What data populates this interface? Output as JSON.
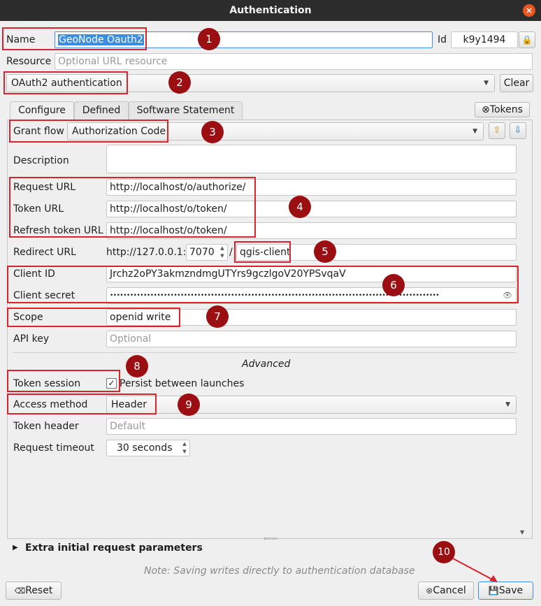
{
  "window": {
    "title": "Authentication",
    "close_icon": "×"
  },
  "name": {
    "label": "Name",
    "value": "GeoNode Oauth2"
  },
  "id": {
    "label": "Id",
    "value": "k9y1494",
    "lock_icon": "🔒"
  },
  "resource": {
    "label": "Resource",
    "placeholder": "Optional URL resource"
  },
  "method": {
    "selected": "OAuth2 authentication",
    "clear_label": "Clear"
  },
  "tabs": [
    {
      "label": "Configure"
    },
    {
      "label": "Defined"
    },
    {
      "label": "Software Statement"
    }
  ],
  "tokens_label": "Tokens",
  "tokens_icon": "⊗",
  "grant_flow": {
    "label": "Grant flow",
    "selected": "Authorization Code"
  },
  "description": {
    "label": "Description"
  },
  "request_url": {
    "label": "Request URL",
    "value": "http://localhost/o/authorize/"
  },
  "token_url": {
    "label": "Token URL",
    "value": "http://localhost/o/token/"
  },
  "refresh_url": {
    "label": "Refresh token URL",
    "value": "http://localhost/o/token/"
  },
  "redirect": {
    "label": "Redirect URL",
    "host": "http://127.0.0.1:",
    "port": "7070",
    "slash": "/",
    "path": "qgis-client"
  },
  "client_id": {
    "label": "Client ID",
    "value": "Jrchz2oPY3akmzndmgUTYrs9gczlgoV20YPSvqaV"
  },
  "client_secret": {
    "label": "Client secret",
    "value": "••••••••••••••••••••••••••••••••••••••••••••••••••••••••••••••••••••••••••••••••••••••••••••••••••",
    "eye_icon": "👁"
  },
  "scope": {
    "label": "Scope",
    "value": "openid write"
  },
  "api_key": {
    "label": "API key",
    "placeholder": "Optional"
  },
  "advanced_heading": "Advanced",
  "token_session": {
    "label": "Token session",
    "checkbox": "✓",
    "checkbox_label": "Persist between launches"
  },
  "access_method": {
    "label": "Access method",
    "selected": "Header"
  },
  "token_header": {
    "label": "Token header",
    "placeholder": "Default"
  },
  "request_timeout": {
    "label": "Request timeout",
    "value": "30 seconds"
  },
  "extra_params": {
    "label": "Extra initial request parameters",
    "arrow": "▶"
  },
  "note": "Note: Saving writes directly to authentication database",
  "buttons": {
    "reset": "Reset",
    "reset_icon": "⌫",
    "cancel": "Cancel",
    "cancel_icon": "⊗",
    "save": "Save",
    "save_icon": "💾"
  },
  "annotations": [
    "1",
    "2",
    "3",
    "4",
    "5",
    "6",
    "7",
    "8",
    "9",
    "10"
  ],
  "colors": {
    "annotation_red": "#d9232d",
    "badge": "#9b0f12",
    "selection": "#3d8ee0"
  }
}
